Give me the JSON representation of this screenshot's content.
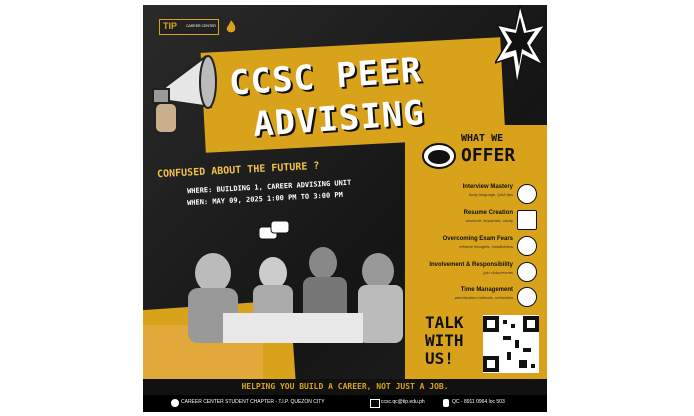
{
  "brand": {
    "logo": "TIP",
    "tag": "CAREER CENTER"
  },
  "headline": {
    "line1": "CCSC PEER",
    "line2": "ADVISING"
  },
  "question": "CONFUSED ABOUT THE FUTURE ?",
  "where": "WHERE: BUILDING 1, CAREER ADVISING UNIT",
  "when": "WHEN: MAY 09, 2025  1:00 PM TO 3:00 PM",
  "offer": {
    "line1": "WHAT WE",
    "line2": "OFFER",
    "items": [
      {
        "title": "Interview Mastery",
        "sub": "body language, Q&A tips"
      },
      {
        "title": "Resume Creation",
        "sub": "structure, keywords, clarity"
      },
      {
        "title": "Overcoming Exam Fears",
        "sub": "reframe thoughts, mindfulness"
      },
      {
        "title": "Involvement & Responsibility",
        "sub": "join clubs/events"
      },
      {
        "title": "Time Management",
        "sub": "prioritization methods, schedules"
      }
    ]
  },
  "talk": {
    "line1": "TALK",
    "line2": "WITH",
    "line3": "US!"
  },
  "tagline": "HELPING YOU BUILD A CAREER, NOT JUST A JOB.",
  "footer": {
    "fb": "CAREER CENTER STUDENT CHAPTER - T.I.P. QUEZON CITY",
    "email": "ccsc.qc@tip.edu.ph",
    "phone": "QC - 8911 0964 loc 503"
  },
  "colors": {
    "gold": "#d9a21b",
    "black": "#111111"
  }
}
